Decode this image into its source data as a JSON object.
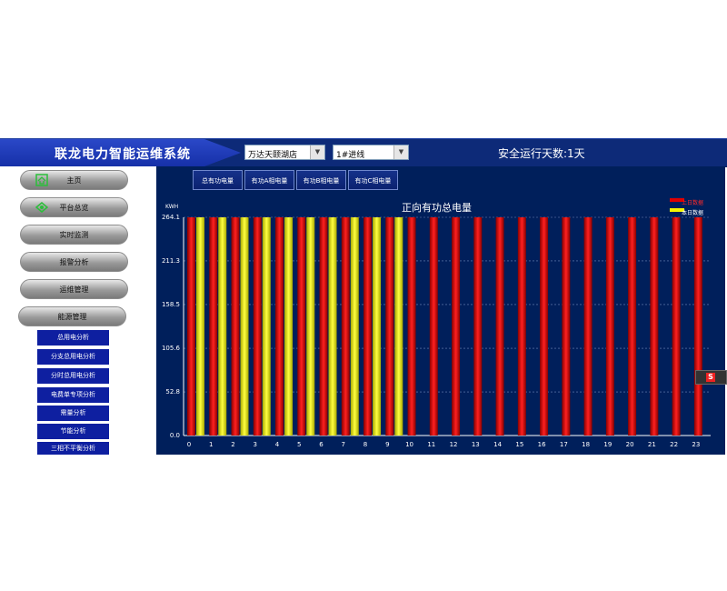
{
  "header": {
    "title": "联龙电力智能运维系统",
    "site_select": "万达天颐湖店",
    "line_select": "1#进线",
    "uptime": "安全运行天数:1天"
  },
  "sidebar": {
    "menu": [
      {
        "label": "主页",
        "icon": "home-icon"
      },
      {
        "label": "平台总览",
        "icon": "overview-icon"
      },
      {
        "label": "实时监测"
      },
      {
        "label": "报警分析"
      },
      {
        "label": "运维管理"
      },
      {
        "label": "能源管理"
      }
    ],
    "submenu": [
      "总用电分析",
      "分支总用电分析",
      "分时总用电分析",
      "电费单专项分析",
      "需量分析",
      "节能分析",
      "三相不平衡分析"
    ]
  },
  "tabs": [
    "总有功电量",
    "有功A相电量",
    "有功B相电量",
    "有功C相电量"
  ],
  "colors": {
    "header_bg": "#0d2a78",
    "chart_bg": "#001f5b",
    "prev_day": "#e00000",
    "today": "#f5f500"
  },
  "chart_data": {
    "type": "bar",
    "title": "正向有功总电量",
    "ylabel": "KWH",
    "ylim": [
      0,
      264.1
    ],
    "yticks": [
      "0.0",
      "52.8",
      "105.6",
      "158.5",
      "211.3",
      "264.1"
    ],
    "categories": [
      "0",
      "1",
      "2",
      "3",
      "4",
      "5",
      "6",
      "7",
      "8",
      "9",
      "10",
      "11",
      "12",
      "13",
      "14",
      "15",
      "16",
      "17",
      "18",
      "19",
      "20",
      "21",
      "22",
      "23"
    ],
    "series": [
      {
        "name": "上日数据",
        "color": "#e00000",
        "values": [
          264.1,
          264.1,
          264.1,
          264.1,
          264.1,
          264.1,
          264.1,
          264.1,
          264.1,
          264.1,
          264.1,
          264.1,
          264.1,
          264.1,
          264.1,
          264.1,
          264.1,
          264.1,
          264.1,
          264.1,
          264.1,
          264.1,
          264.1,
          264.1
        ]
      },
      {
        "name": "本日数据",
        "color": "#f5f500",
        "values": [
          264.1,
          264.1,
          264.1,
          264.1,
          264.1,
          264.1,
          264.1,
          264.1,
          264.1,
          264.1
        ]
      }
    ],
    "grid": true,
    "legend": "top-right"
  }
}
